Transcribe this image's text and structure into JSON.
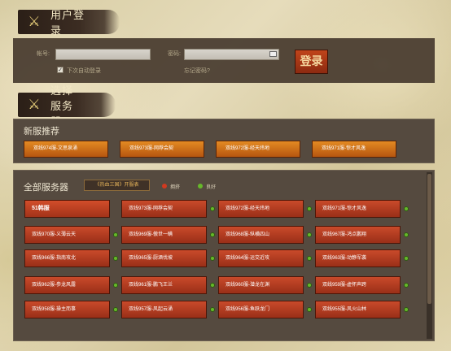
{
  "login_banner": {
    "title": "用户登录",
    "icon": "sword-shield-icon"
  },
  "login": {
    "account_label": "帐号:",
    "password_label": "密码:",
    "remember_label": "下次自动登录",
    "remember_checked": true,
    "forgot_label": "忘记密码?",
    "submit_label": "登录",
    "keyboard_icon": "keyboard-icon"
  },
  "server_banner": {
    "title": "选择服务器",
    "icon": "crossed-swords-icon"
  },
  "new_servers": {
    "title": "新服推荐",
    "items": [
      "双线974服-文思泉涌",
      "双线973服-网荐会契",
      "双线972服-经天纬地",
      "双线971服-惊才风逸"
    ]
  },
  "all_servers": {
    "title": "全部服务器",
    "tag_button": "《热血三国》开服表",
    "legend": [
      {
        "label": "拥挤",
        "color": "#d03a20"
      },
      {
        "label": "良好",
        "color": "#66b82a"
      }
    ],
    "rows": [
      [
        "51韩服",
        "双线973服-网荐会契",
        "双线972服-经天纬地",
        "双线971服-惊才风逸"
      ],
      [
        "双线970服-义薄云天",
        "双线969服-傲世一瞒",
        "双线968服-纵横四山",
        "双线967服-鸿点鹏翔"
      ],
      [
        "双线966服-指南攻北",
        "双线965服-厨酒伐坡",
        "双线964服-运交近攻",
        "双线963服-动静军袭"
      ],
      [
        "双线962服-参龙风露",
        "双线961服-鹏飞王兰",
        "双线960服-潜龙在渊",
        "双线959服-虚怀声跨"
      ],
      [
        "双线958服-操主而事",
        "双线957服-风起云涌",
        "双线956服-鱼跃龙门",
        "双线955服-风火山林"
      ]
    ]
  },
  "colors": {
    "accent": "#c0441a",
    "good": "#66b82a",
    "crowded": "#d03a20",
    "panel": "#554a3f"
  }
}
